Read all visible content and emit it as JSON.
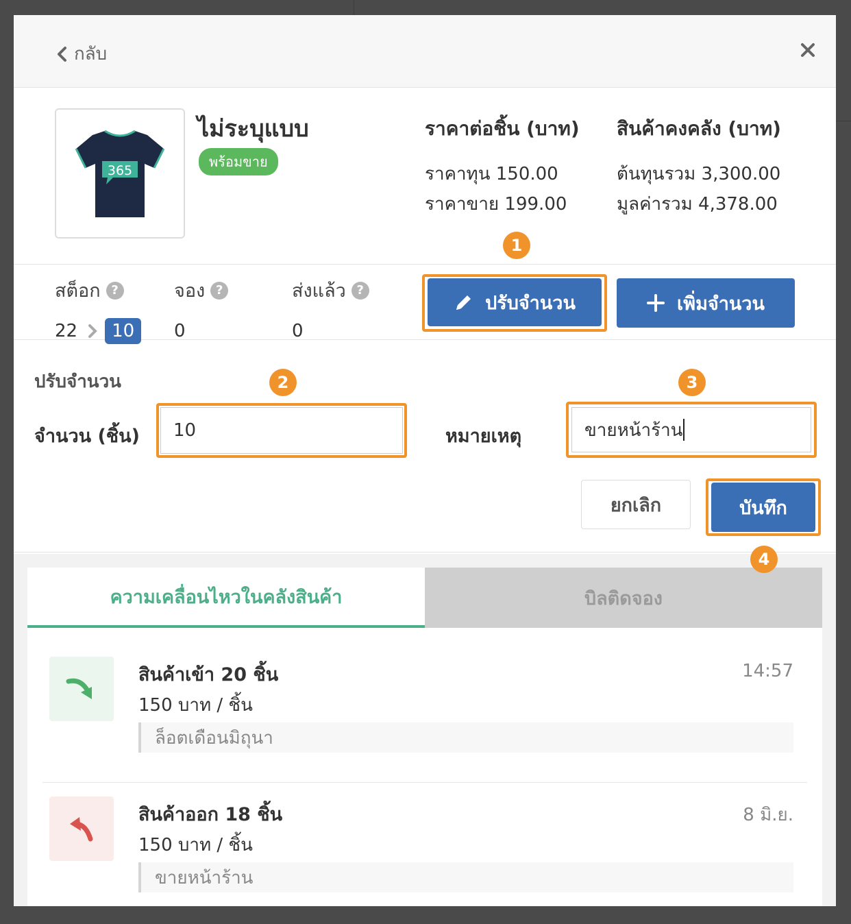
{
  "header": {
    "back_label": "กลับ"
  },
  "product": {
    "name": "ไม่ระบุแบบ",
    "status_badge": "พร้อมขาย",
    "shirt_text": "365",
    "price_heading": "ราคาต่อชิ้น (บาท)",
    "cost_price": "ราคาทุน 150.00",
    "sell_price": "ราคาขาย 199.00",
    "inventory_heading": "สินค้าคงคลัง (บาท)",
    "total_cost": "ต้นทุนรวม 3,300.00",
    "total_value": "มูลค่ารวม 4,378.00"
  },
  "stock": {
    "stock_label": "สต็อก",
    "stock_value": "22",
    "stock_new_value": "10",
    "reserved_label": "จอง",
    "reserved_value": "0",
    "shipped_label": "ส่งแล้ว",
    "shipped_value": "0",
    "help_glyph": "?",
    "adjust_button": "ปรับจำนวน",
    "add_button": "เพิ่มจำนวน"
  },
  "adjust_form": {
    "title": "ปรับจำนวน",
    "quantity_label": "จำนวน (ชิ้น)",
    "quantity_value": "10",
    "note_label": "หมายเหตุ",
    "note_value": "ขายหน้าร้าน",
    "cancel_button": "ยกเลิก",
    "save_button": "บันทึก"
  },
  "steps": [
    "1",
    "2",
    "3",
    "4"
  ],
  "tabs": [
    {
      "label": "ความเคลื่อนไหวในคลังสินค้า",
      "active": true
    },
    {
      "label": "บิลติดจอง",
      "active": false
    }
  ],
  "movements": [
    {
      "title": "สินค้าเข้า 20 ชิ้น",
      "price": "150 บาท / ชิ้น",
      "note": "ล็อตเดือนมิถุนา",
      "time": "14:57",
      "direction": "in",
      "icon": "arrow-in-icon"
    },
    {
      "title": "สินค้าออก 18 ชิ้น",
      "price": "150 บาท / ชิ้น",
      "note": "ขายหน้าร้าน",
      "time": "8 มิ.ย.",
      "direction": "out",
      "icon": "arrow-out-icon"
    }
  ],
  "colors": {
    "primary_blue": "#3a6fb5",
    "highlight_orange": "#f0932b",
    "success_green": "#5cb85c",
    "tab_green": "#4caf8a",
    "out_red": "#d9534f"
  }
}
